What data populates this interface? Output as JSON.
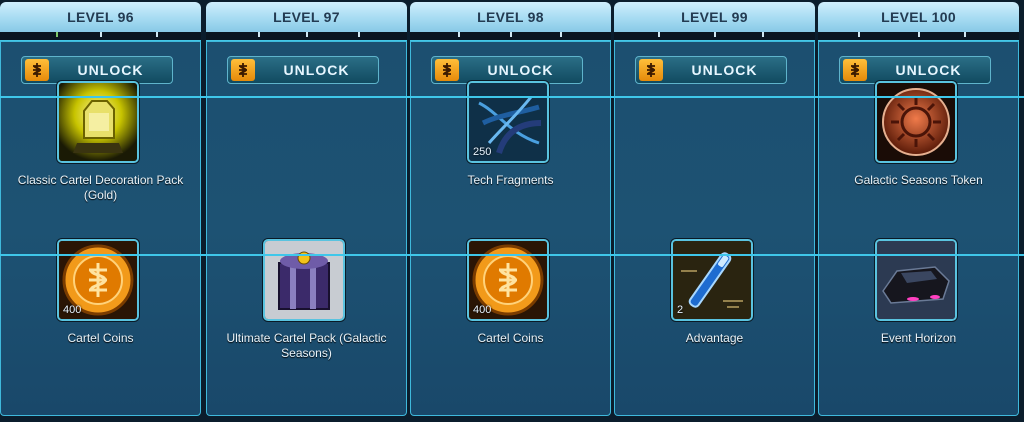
{
  "columns": [
    {
      "level": "LEVEL 96",
      "unlock": "UNLOCK",
      "row1": {
        "name": "Classic Cartel Decoration Pack (Gold)",
        "icon": "gold-decoration-pack-icon",
        "qty": ""
      },
      "row2": {
        "name": "Cartel Coins",
        "icon": "cartel-coins-icon",
        "qty": "400"
      }
    },
    {
      "level": "LEVEL 97",
      "unlock": "UNLOCK",
      "row1": null,
      "row2": {
        "name": "Ultimate Cartel Pack (Galactic Seasons)",
        "icon": "ultimate-cartel-pack-icon",
        "qty": ""
      }
    },
    {
      "level": "LEVEL 98",
      "unlock": "UNLOCK",
      "row1": {
        "name": "Tech Fragments",
        "icon": "tech-fragments-icon",
        "qty": "250"
      },
      "row2": {
        "name": "Cartel Coins",
        "icon": "cartel-coins-icon",
        "qty": "400"
      }
    },
    {
      "level": "LEVEL 99",
      "unlock": "UNLOCK",
      "row1": null,
      "row2": {
        "name": "Advantage",
        "icon": "advantage-icon",
        "qty": "2"
      }
    },
    {
      "level": "LEVEL 100",
      "unlock": "UNLOCK",
      "row1": {
        "name": "Galactic Seasons Token",
        "icon": "galactic-seasons-token-icon",
        "qty": ""
      },
      "row2": {
        "name": "Event Horizon",
        "icon": "event-horizon-vehicle-icon",
        "qty": ""
      }
    }
  ],
  "colors": {
    "header": "#a6dbf2",
    "panel": "#1c4f70",
    "border": "#3fc7ea",
    "unlock_icon": "#f0a020"
  }
}
